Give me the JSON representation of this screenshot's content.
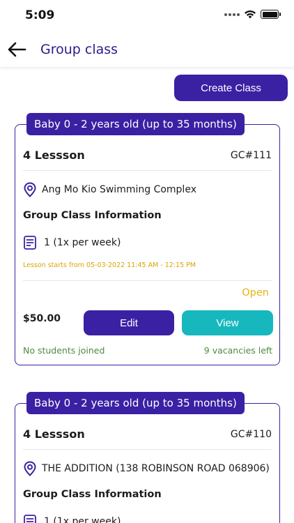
{
  "status_bar": {
    "time": "5:09"
  },
  "nav": {
    "title": "Group class",
    "back_icon": "arrow-left-icon"
  },
  "actions": {
    "create_label": "Create Class"
  },
  "colors": {
    "primary": "#3a21a3",
    "teal": "#16b8be",
    "status_open": "#e7b30e",
    "lesson_start": "#d9a400",
    "green_text": "#4c8a3f",
    "title_text": "#2d1a8c"
  },
  "classes": [
    {
      "age_group": "Baby 0 - 2 years old (up to 35 months)",
      "lessons": "4 Lessson",
      "code": "GC#111",
      "venue": "Ang Mo Kio Swimming Complex",
      "info_heading": "Group Class Information",
      "frequency": "1 (1x per week)",
      "lesson_start": "Lesson starts from 05-03-2022 11:45 AM - 12:15 PM",
      "status": "Open",
      "price": "$50.00",
      "edit_label": "Edit",
      "view_label": "View",
      "students_joined": "No students joined",
      "vacancies": "9 vacancies left"
    },
    {
      "age_group": "Baby 0 - 2 years old (up to 35 months)",
      "lessons": "4 Lessson",
      "code": "GC#110",
      "venue": "THE ADDITION (138 ROBINSON ROAD 068906)",
      "info_heading": "Group Class Information",
      "frequency": "1 (1x per week)"
    }
  ]
}
